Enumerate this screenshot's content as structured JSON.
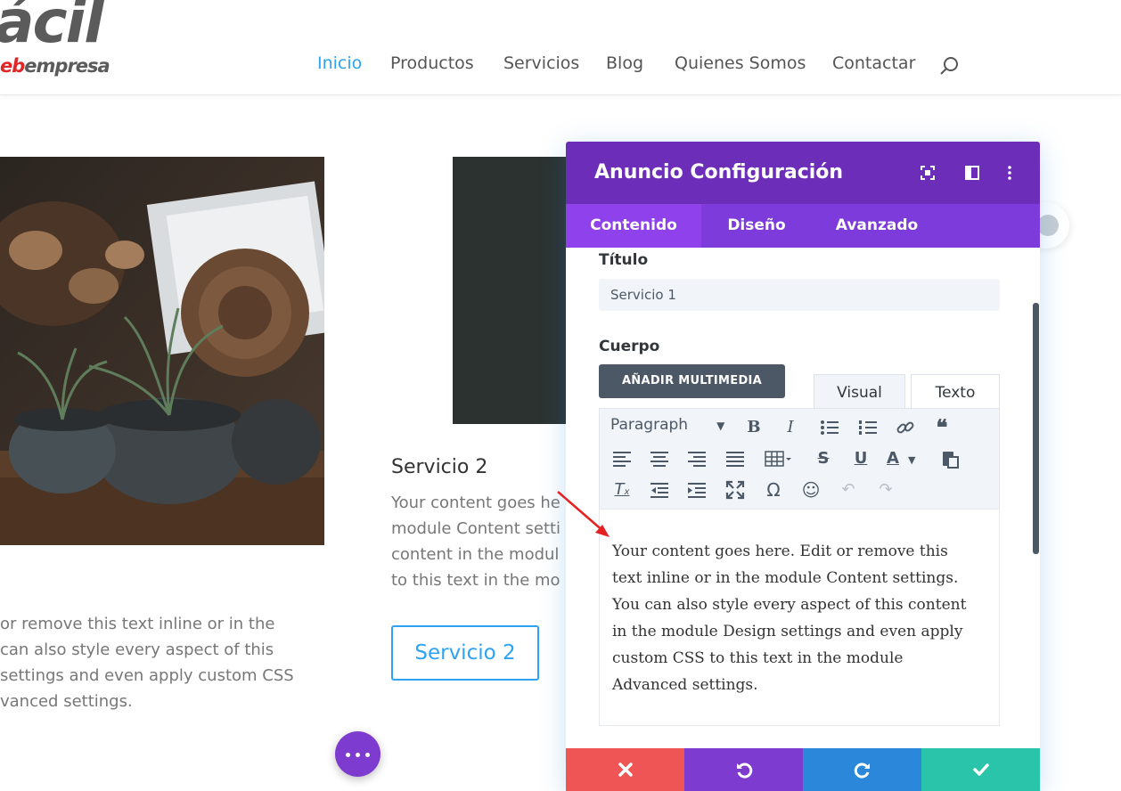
{
  "header": {
    "logo_main": "ácil",
    "logo_sub_red": "eb",
    "logo_sub_rest": "empresa",
    "nav": [
      "Inicio",
      "Productos",
      "Servicios",
      "Blog",
      "Quienes Somos",
      "Contactar"
    ],
    "active_nav": "Inicio"
  },
  "content": {
    "service2_title": "Servicio 2",
    "service2_text_lines": [
      "Your content goes he",
      "module Content setti",
      "content in the modul",
      "to this text in the mo"
    ],
    "left_text_lines": [
      "or remove this text inline or in the",
      " can also style every aspect of this",
      " settings and even apply custom CSS",
      "vanced settings."
    ],
    "service2_button": "Servicio 2"
  },
  "panel": {
    "title": "Anuncio Configuración",
    "tabs": [
      "Contenido",
      "Diseño",
      "Avanzado"
    ],
    "active_tab": "Contenido",
    "title_label": "Título",
    "title_value": "Servicio 1",
    "body_label": "Cuerpo",
    "media_button": "AÑADIR MULTIMEDIA",
    "editor_tabs": [
      "Visual",
      "Texto"
    ],
    "active_editor_tab": "Visual",
    "format_select": "Paragraph",
    "editor_lines": [
      "Your content goes here. Edit or remove this",
      "text inline or in the module Content settings.",
      "You can also style every aspect of this content",
      "in the module Design settings and even apply",
      "custom CSS to this text in the module",
      "Advanced settings."
    ]
  },
  "colors": {
    "accent": "#2ea3f2",
    "panel_header": "#6c2eb9",
    "panel_tabs": "#7d3bdb",
    "footer_cancel": "#ef5555",
    "footer_undo": "#7e3bd0",
    "footer_redo": "#2b87da",
    "footer_save": "#29c4a9"
  }
}
